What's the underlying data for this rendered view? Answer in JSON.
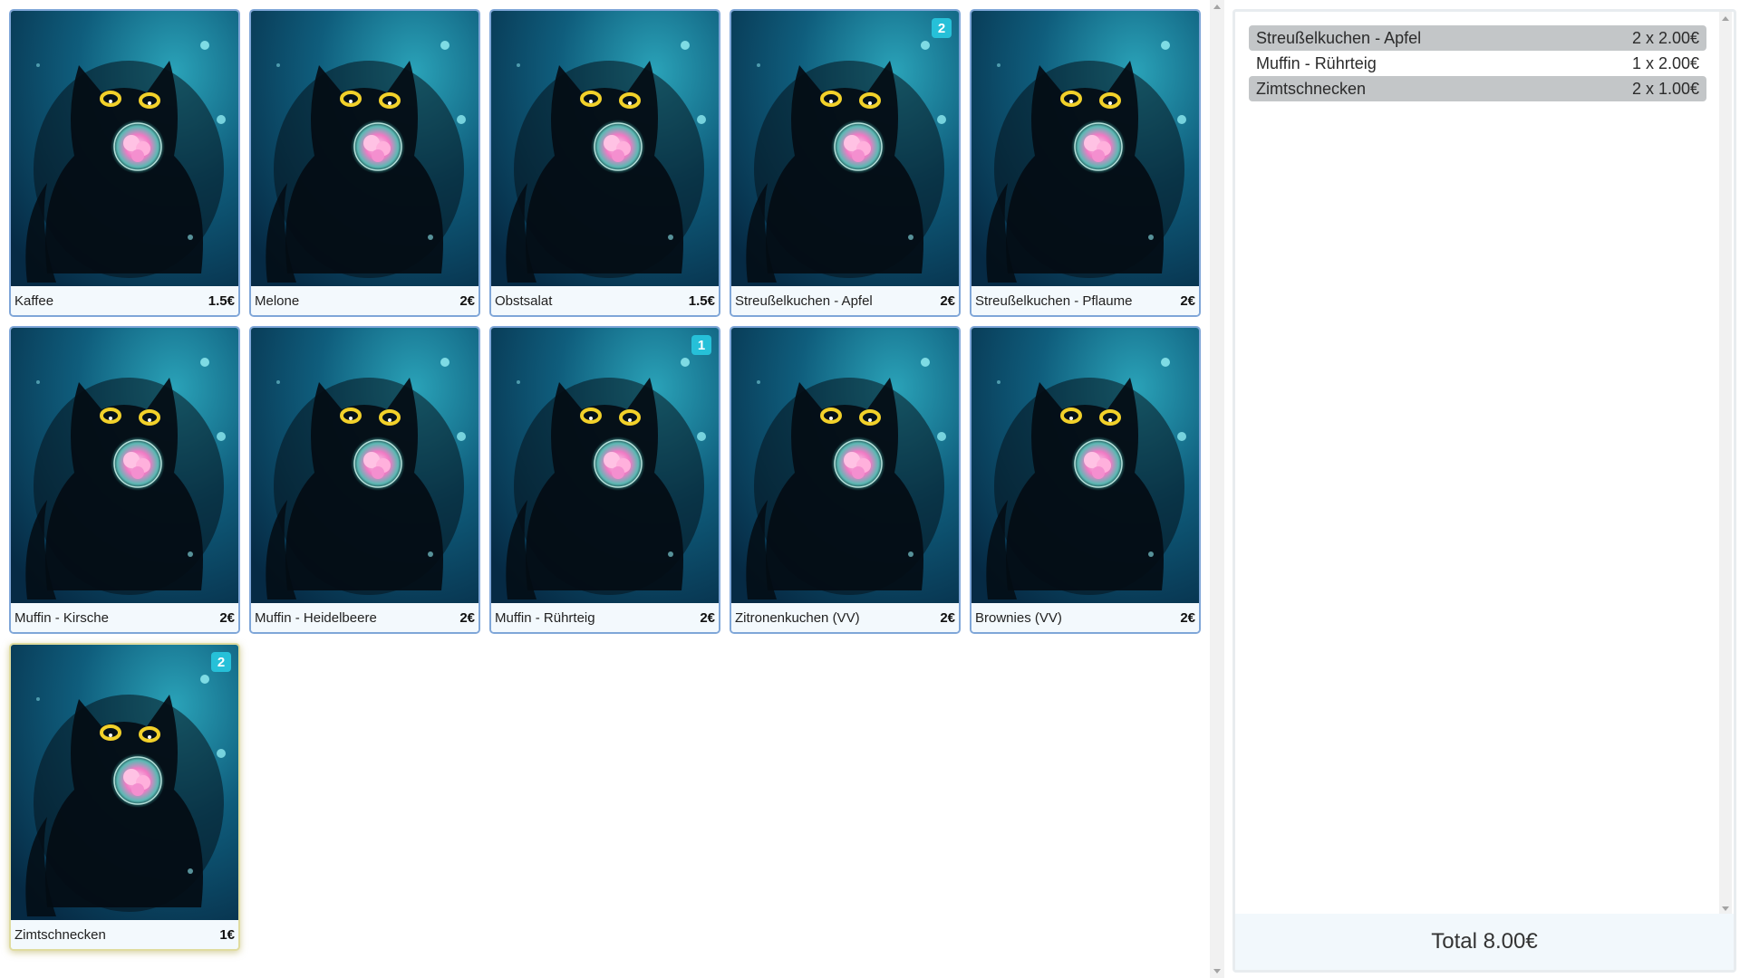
{
  "products": [
    {
      "name": "Kaffee",
      "price": "1.5€",
      "badge": ""
    },
    {
      "name": "Melone",
      "price": "2€",
      "badge": ""
    },
    {
      "name": "Obstsalat",
      "price": "1.5€",
      "badge": ""
    },
    {
      "name": "Streußelkuchen - Apfel",
      "price": "2€",
      "badge": "2"
    },
    {
      "name": "Streußelkuchen - Pflaume",
      "price": "2€",
      "badge": ""
    },
    {
      "name": "Muffin - Kirsche",
      "price": "2€",
      "badge": ""
    },
    {
      "name": "Muffin - Heidelbeere",
      "price": "2€",
      "badge": ""
    },
    {
      "name": "Muffin - Rührteig",
      "price": "2€",
      "badge": "1"
    },
    {
      "name": "Zitronenkuchen (VV)",
      "price": "2€",
      "badge": ""
    },
    {
      "name": "Brownies (VV)",
      "price": "2€",
      "badge": ""
    },
    {
      "name": "Zimtschnecken",
      "price": "1€",
      "badge": "2",
      "selected": true
    }
  ],
  "order": {
    "items": [
      {
        "name": "Streußelkuchen - Apfel",
        "qty": "2 x 2.00€"
      },
      {
        "name": "Muffin - Rührteig",
        "qty": "1 x 2.00€"
      },
      {
        "name": "Zimtschnecken",
        "qty": "2 x 1.00€"
      }
    ],
    "total_label": "Total 8.00€"
  },
  "colors": {
    "card_border": "#7fa6d8",
    "badge": "#26c0d8",
    "order_row_shade": "#c3c6c8",
    "total_bg": "#f2f8fc"
  },
  "icons": {
    "product_image": "black-cat-underwater-image"
  }
}
